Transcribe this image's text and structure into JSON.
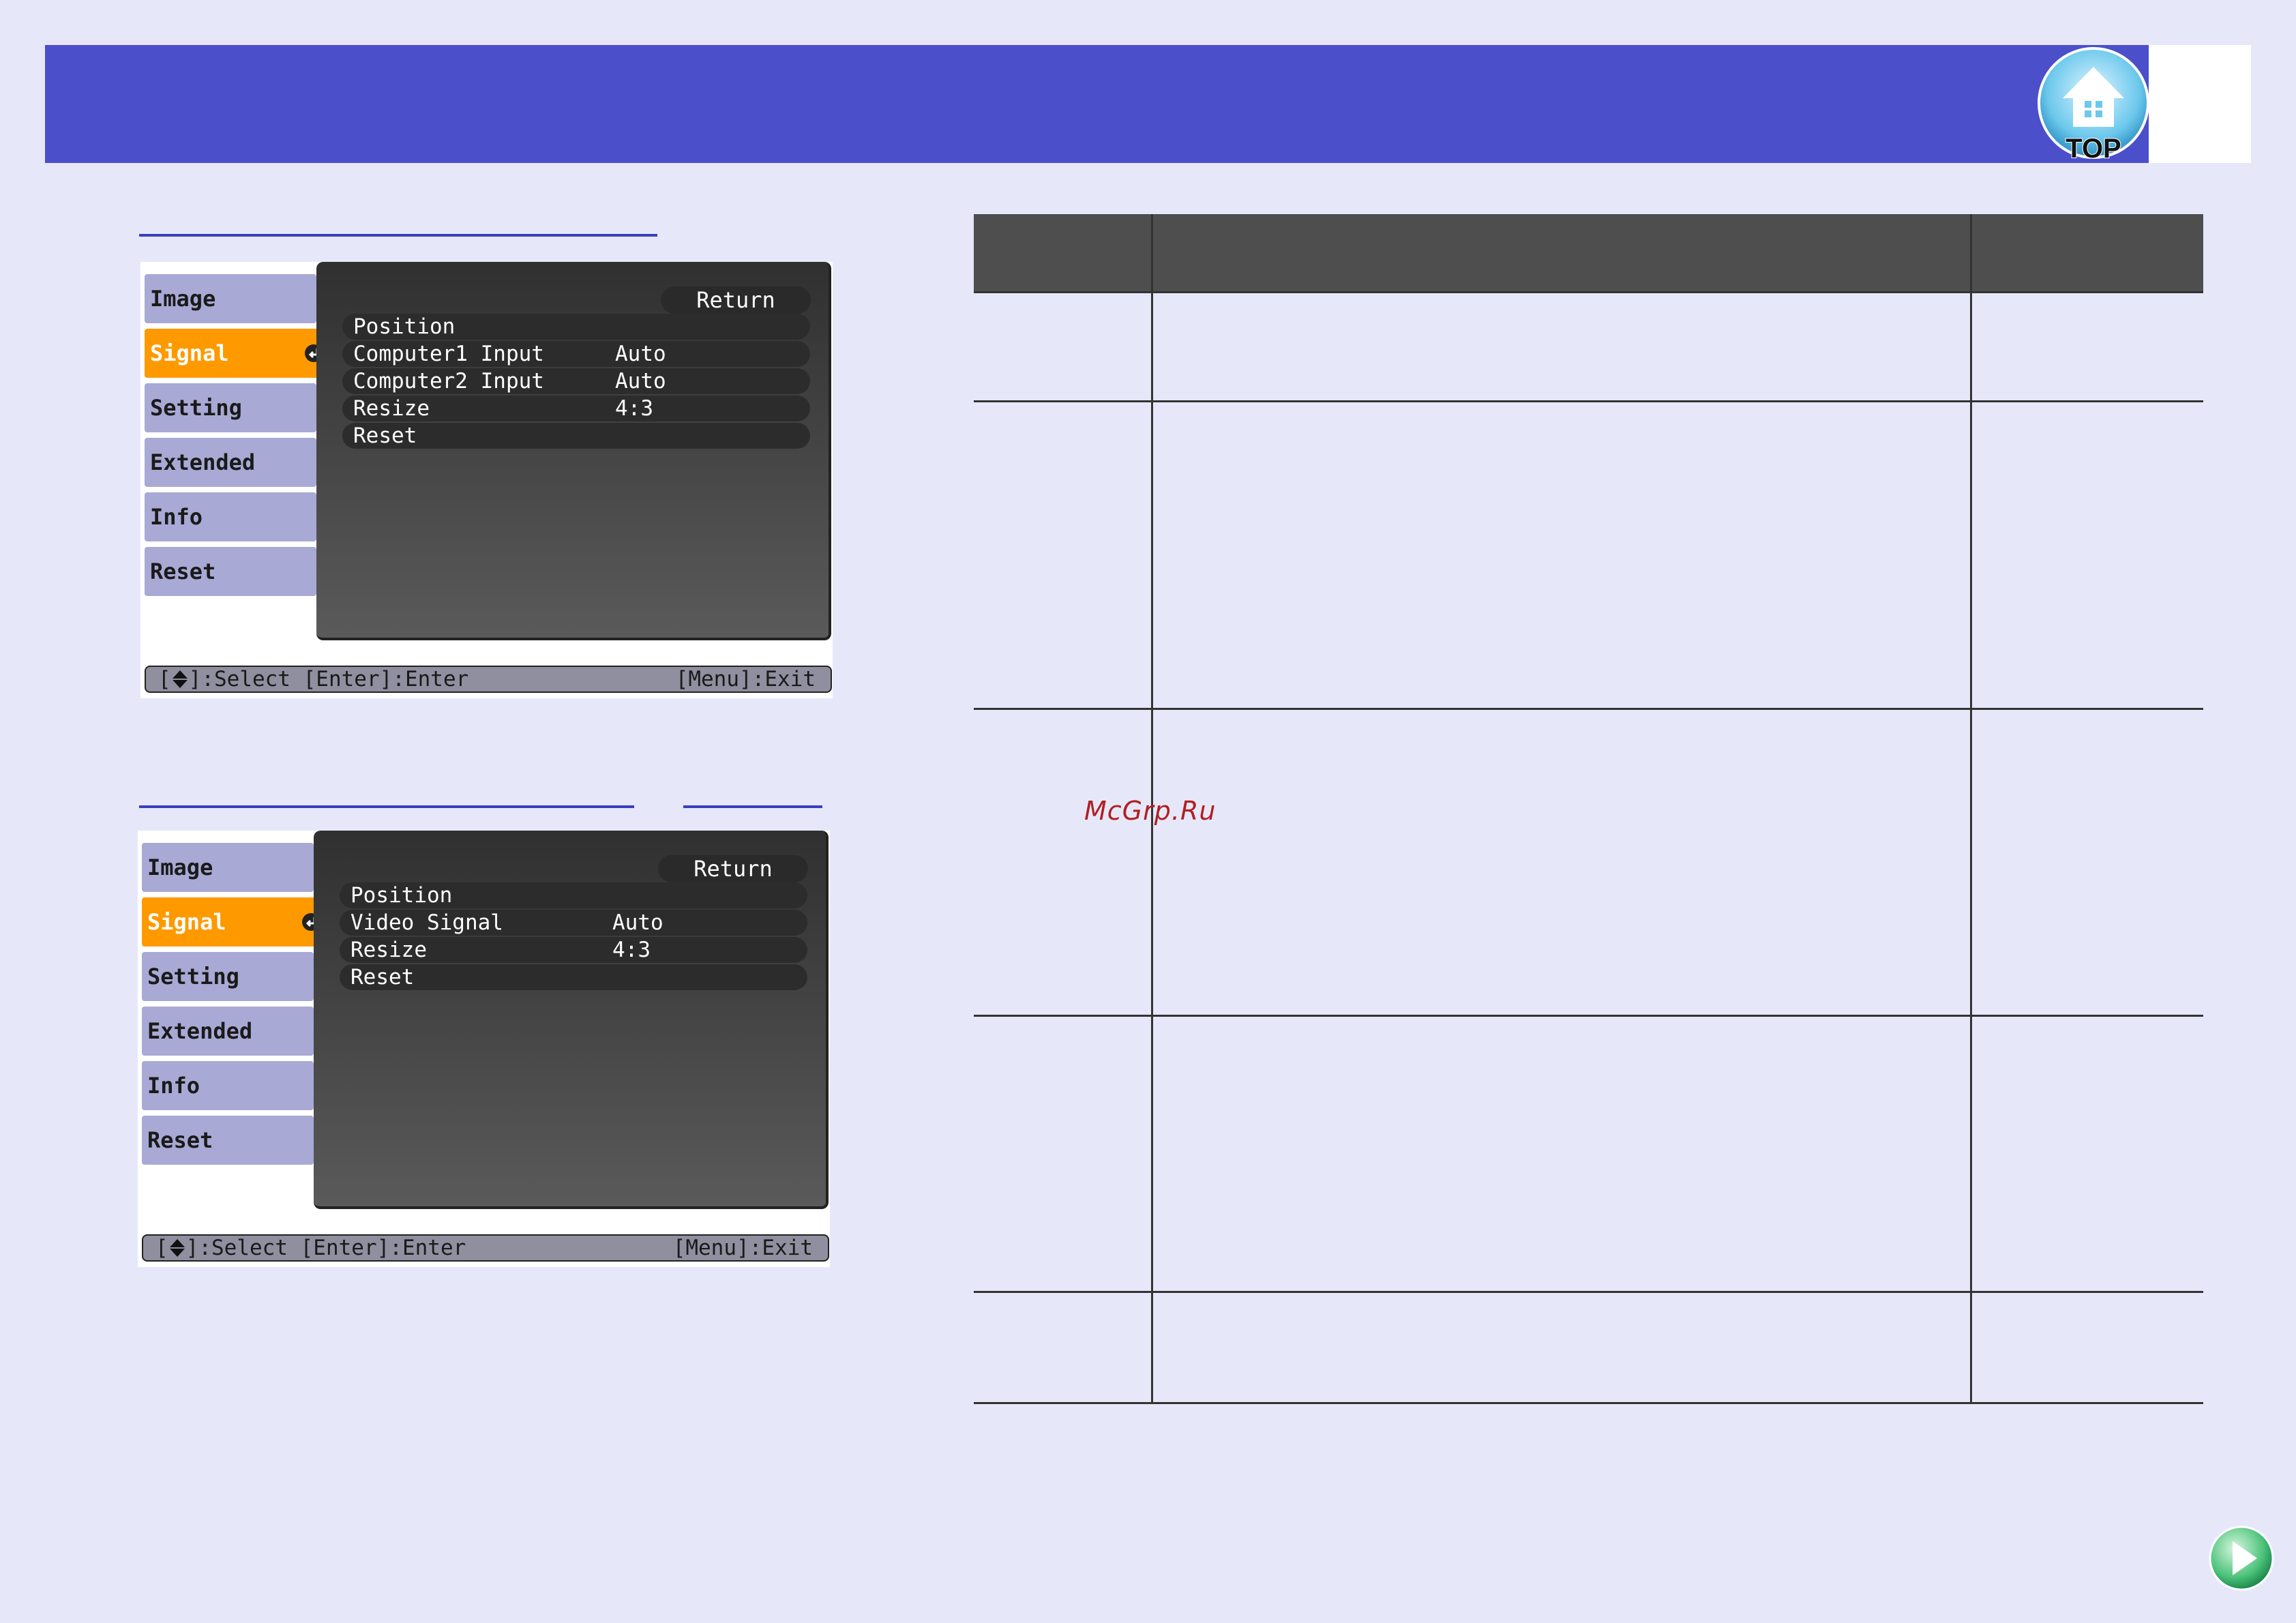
{
  "header": {
    "logo_text": "TOP"
  },
  "computer_menu": {
    "tabs": [
      {
        "label": "Image",
        "active": false
      },
      {
        "label": "Signal",
        "active": true
      },
      {
        "label": "Setting",
        "active": false
      },
      {
        "label": "Extended",
        "active": false
      },
      {
        "label": "Info",
        "active": false
      },
      {
        "label": "Reset",
        "active": false
      }
    ],
    "return_label": "Return",
    "rows": [
      {
        "label": "Position",
        "value": ""
      },
      {
        "label": "Computer1 Input",
        "value": "Auto"
      },
      {
        "label": "Computer2 Input",
        "value": "Auto"
      },
      {
        "label": "Resize",
        "value": "4:3"
      },
      {
        "label": "Reset",
        "value": ""
      }
    ],
    "status_left": "]:Select [Enter]:Enter",
    "status_bracket": "[",
    "status_right": "[Menu]:Exit"
  },
  "video_menu": {
    "tabs": [
      {
        "label": "Image",
        "active": false
      },
      {
        "label": "Signal",
        "active": true
      },
      {
        "label": "Setting",
        "active": false
      },
      {
        "label": "Extended",
        "active": false
      },
      {
        "label": "Info",
        "active": false
      },
      {
        "label": "Reset",
        "active": false
      }
    ],
    "return_label": "Return",
    "rows": [
      {
        "label": "Position",
        "value": ""
      },
      {
        "label": "Video Signal",
        "value": "Auto"
      },
      {
        "label": "Resize",
        "value": "4:3"
      },
      {
        "label": "Reset",
        "value": ""
      }
    ],
    "status_left": "]:Select [Enter]:Enter",
    "status_bracket": "[",
    "status_right": "[Menu]:Exit"
  },
  "watermark": "McGrp.Ru",
  "icons": {
    "top": "home-top-icon",
    "enter": "enter-return-icon",
    "updown": "up-down-arrow-icon",
    "next": "next-page-arrow-icon"
  },
  "colors": {
    "header": "#4b4fca",
    "background": "#e6e8fa",
    "active_tab": "#ff9900",
    "tab": "#a9a9d6",
    "table_header": "#4e4e4e"
  }
}
